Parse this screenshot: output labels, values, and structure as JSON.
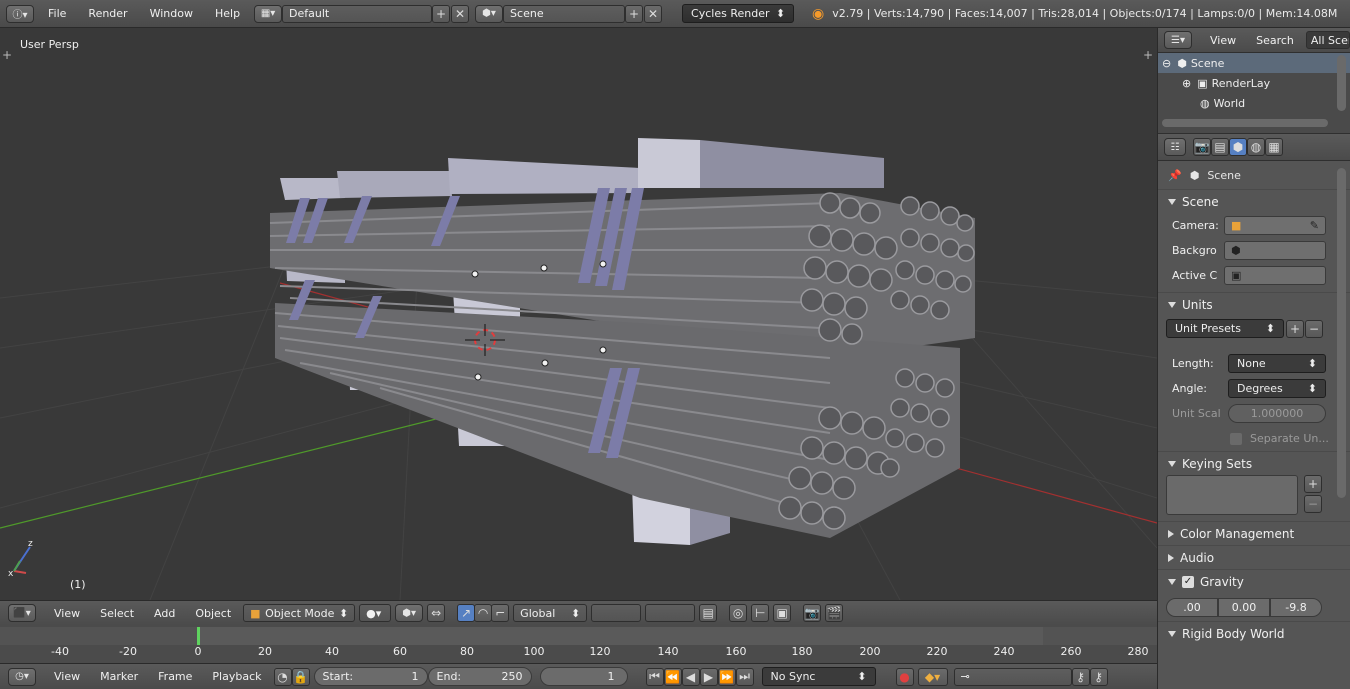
{
  "topbar": {
    "menus": [
      "File",
      "Render",
      "Window",
      "Help"
    ],
    "layout_name": "Default",
    "scene_name": "Scene",
    "render_engine": "Cycles Render",
    "stats": "v2.79 | Verts:14,790 | Faces:14,007 | Tris:28,014 | Objects:0/174 | Lamps:0/0 | Mem:14.08M"
  },
  "viewport": {
    "label": "User Persp",
    "frame_indicator": "(1)"
  },
  "viewport_header": {
    "menus": [
      "View",
      "Select",
      "Add",
      "Object"
    ],
    "mode": "Object Mode",
    "orientation": "Global"
  },
  "timeline": {
    "ticks": [
      "-40",
      "-20",
      "0",
      "20",
      "40",
      "60",
      "80",
      "100",
      "120",
      "140",
      "160",
      "180",
      "200",
      "220",
      "240",
      "260",
      "280"
    ],
    "menus": [
      "View",
      "Marker",
      "Frame",
      "Playback"
    ],
    "start_label": "Start:",
    "start_value": "1",
    "end_label": "End:",
    "end_value": "250",
    "current_frame": "1",
    "sync": "No Sync"
  },
  "outliner": {
    "header_items": [
      "View",
      "Search",
      "All Scen"
    ],
    "rows": [
      "Scene",
      "RenderLay",
      "World"
    ]
  },
  "properties": {
    "breadcrumb": "Scene",
    "scene_panel": {
      "title": "Scene",
      "camera_label": "Camera:",
      "background_label": "Backgro",
      "active_clip_label": "Active C"
    },
    "units_panel": {
      "title": "Units",
      "presets": "Unit Presets",
      "length_label": "Length:",
      "length_value": "None",
      "angle_label": "Angle:",
      "angle_value": "Degrees",
      "unit_scale_label": "Unit Scal",
      "unit_scale_value": "1.000000",
      "separate_units": "Separate Un..."
    },
    "keying_sets_title": "Keying Sets",
    "color_management_title": "Color Management",
    "audio_title": "Audio",
    "gravity_panel": {
      "title": "Gravity",
      "x": ".00",
      "y": "0.00",
      "z": "-9.8"
    },
    "rigid_body_title": "Rigid Body World"
  },
  "colors": {
    "accent": "#5680c2",
    "timeline_cursor": "#5fd35f",
    "x_axis": "#a33030",
    "y_axis": "#4f9a2a"
  }
}
